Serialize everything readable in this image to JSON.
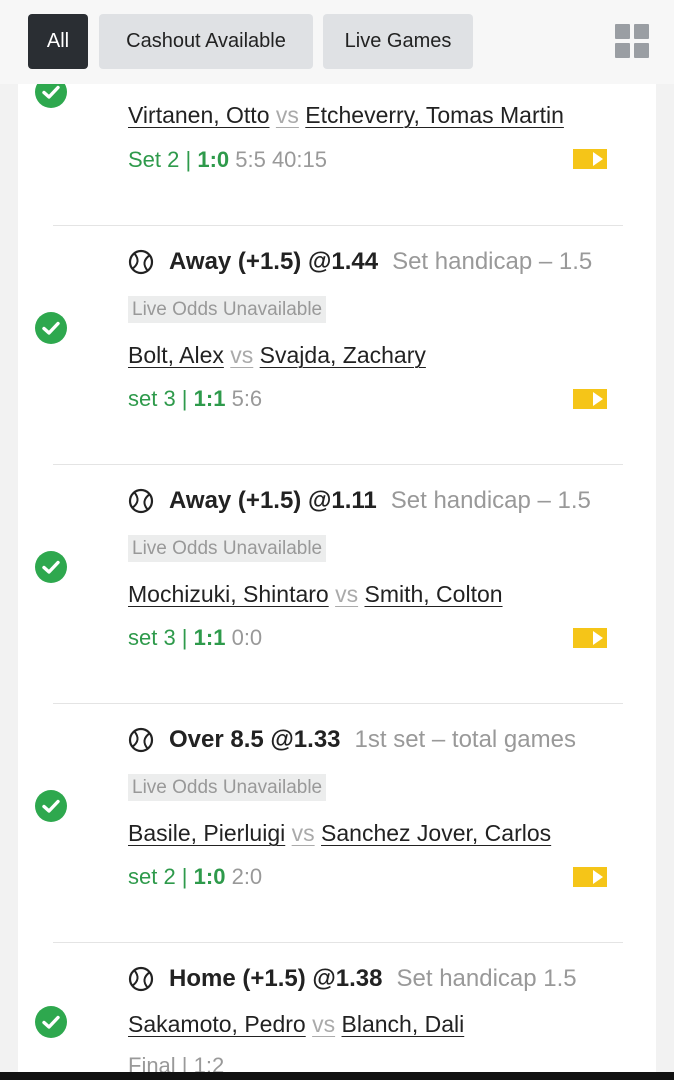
{
  "tabs": [
    {
      "label": "All",
      "active": true
    },
    {
      "label": "Cashout Available",
      "active": false
    },
    {
      "label": "Live Games",
      "active": false
    }
  ],
  "layout_icon": "grid-view-icon",
  "colors": {
    "success": "#2ea84e",
    "score_green": "#2e9a4b",
    "tv_yellow": "#f5c518",
    "tab_active": "#2a2e33"
  },
  "bets": [
    {
      "teams": {
        "home": "Virtanen, Otto",
        "vs": "vs",
        "away": "Etcheverry, Tomas Martin"
      },
      "score": {
        "set": "Set 2 |",
        "sets": "1:0",
        "rest": "5:5 40:15"
      }
    },
    {
      "pick": "Away (+1.5) @1.44",
      "market": "Set handicap  – 1.5",
      "badge": "Live Odds Unavailable",
      "teams": {
        "home": "Bolt, Alex",
        "vs": "vs",
        "away": "Svajda, Zachary"
      },
      "score": {
        "set": "set 3 |",
        "sets": "1:1",
        "rest": "5:6"
      }
    },
    {
      "pick": "Away (+1.5) @1.11",
      "market": "Set handicap  – 1.5",
      "badge": "Live Odds Unavailable",
      "teams": {
        "home": "Mochizuki, Shintaro",
        "vs": "vs",
        "away": "Smith, Colton"
      },
      "score": {
        "set": "set 3 |",
        "sets": "1:1",
        "rest": "0:0"
      }
    },
    {
      "pick": "Over 8.5 @1.33",
      "market": "1st set  –  total games",
      "badge": "Live Odds Unavailable",
      "teams": {
        "home": "Basile, Pierluigi",
        "vs": "vs",
        "away": "Sanchez Jover, Carlos"
      },
      "score": {
        "set": "set 2 |",
        "sets": "1:0",
        "rest": "2:0"
      }
    },
    {
      "pick": "Home (+1.5) @1.38",
      "market": "Set handicap 1.5",
      "teams": {
        "home": "Sakamoto, Pedro",
        "vs": "vs",
        "away": "Blanch, Dali"
      },
      "score": {
        "final": "Final | 1:2"
      }
    }
  ]
}
